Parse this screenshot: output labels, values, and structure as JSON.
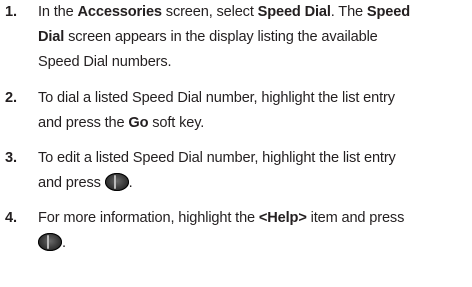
{
  "steps": [
    {
      "number": "1.",
      "parts": {
        "t1": "In the ",
        "b1": "Accessories",
        "t2": " screen, select ",
        "b2": "Speed Dial",
        "t3": ". The ",
        "b3": "Speed",
        "line2_b": "Dial",
        "line2_t": " screen appears in the display listing the available",
        "line3_t": "Speed Dial numbers."
      }
    },
    {
      "number": "2.",
      "parts": {
        "line1_t": "To dial a listed Speed Dial number, highlight the list entry",
        "line2_t1": "and press the ",
        "line2_b": "Go",
        "line2_t2": " soft key."
      }
    },
    {
      "number": "3.",
      "parts": {
        "line1_t": "To edit a listed Speed Dial number, highlight the list entry",
        "line2_t1": "and press ",
        "line2_t2": "."
      },
      "icon": "ok-key-icon"
    },
    {
      "number": "4.",
      "parts": {
        "t1": "For more information, highlight the ",
        "b1": "<Help>",
        "t2": " item and press",
        "line2_t": "."
      },
      "icon": "ok-key-icon"
    }
  ]
}
